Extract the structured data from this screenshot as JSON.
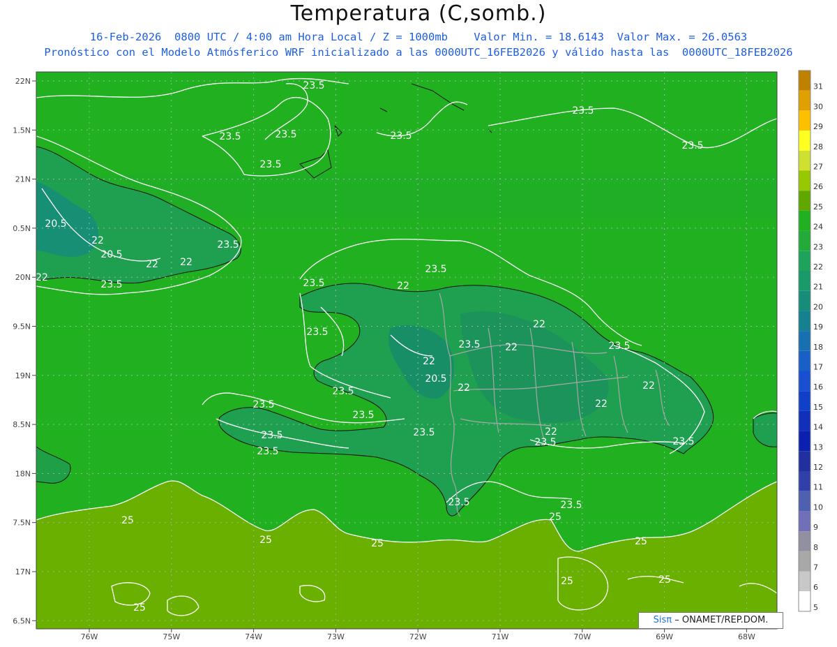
{
  "header": {
    "title": "Temperatura (C,somb.)",
    "subtitle1": "16-Feb-2026  0800 UTC / 4:00 am Hora Local / Z = 1000mb    Valor Min. = 18.6143  Valor Max. = 26.0563",
    "subtitle2": "Pronóstico con el Modelo Atmósferico WRF inicializado a las 0000UTC_16FEB2026 y válido hasta las  0000UTC_18FEB2026"
  },
  "map": {
    "lat_labels": [
      "22N",
      "1.5N",
      "21N",
      "0.5N",
      "20N",
      "9.5N",
      "19N",
      "8.5N",
      "18N",
      "7.5N",
      "17N",
      "6.5N"
    ],
    "lon_labels": [
      "76W",
      "75W",
      "74W",
      "73W",
      "72W",
      "71W",
      "70W",
      "69W",
      "68W"
    ],
    "contour_labels": [
      "23.5",
      "23.5",
      "23.5",
      "23.5",
      "23.5",
      "23.5",
      "20.5",
      "22",
      "20.5",
      "22",
      "22",
      "22",
      "23.5",
      "23.5",
      "23.5",
      "22",
      "23.5",
      "23.5",
      "22",
      "23.5",
      "22",
      "22",
      "20.5",
      "22",
      "23.5",
      "23.5",
      "22",
      "23.5",
      "23.5",
      "22",
      "23.5",
      "23.5",
      "23.5",
      "23.5",
      "23.5",
      "25",
      "25",
      "25",
      "25",
      "25",
      "25",
      "25",
      "25"
    ],
    "colors": {
      "ocean_green": "#20b020",
      "warm_olive": "#6ab000",
      "land_green": "#1f9f50",
      "teal": "#1a8a78"
    }
  },
  "colorbar": {
    "ticks": [
      "31",
      "30",
      "29",
      "28",
      "27",
      "26",
      "25",
      "24",
      "23",
      "22",
      "21",
      "20",
      "19",
      "18",
      "17",
      "16",
      "15",
      "14",
      "13",
      "12",
      "11",
      "10",
      "9",
      "8",
      "7",
      "6",
      "5"
    ],
    "colors": [
      "#c08000",
      "#e0a000",
      "#ffc000",
      "#ffff20",
      "#d0e030",
      "#98c800",
      "#60a800",
      "#20b020",
      "#23ab3a",
      "#1ea45a",
      "#1a9a6a",
      "#168c7a",
      "#148090",
      "#1870b0",
      "#1860c8",
      "#1850d0",
      "#1040c8",
      "#1030b8",
      "#0c20b0",
      "#2030a0",
      "#3040a8",
      "#5060b0",
      "#7070b8",
      "#9090a0",
      "#a8a8a8",
      "#c8c8c8",
      "#ffffff"
    ]
  },
  "credit": {
    "brand": "Sisπ",
    "text": "– ONAMET/REP.DOM."
  }
}
